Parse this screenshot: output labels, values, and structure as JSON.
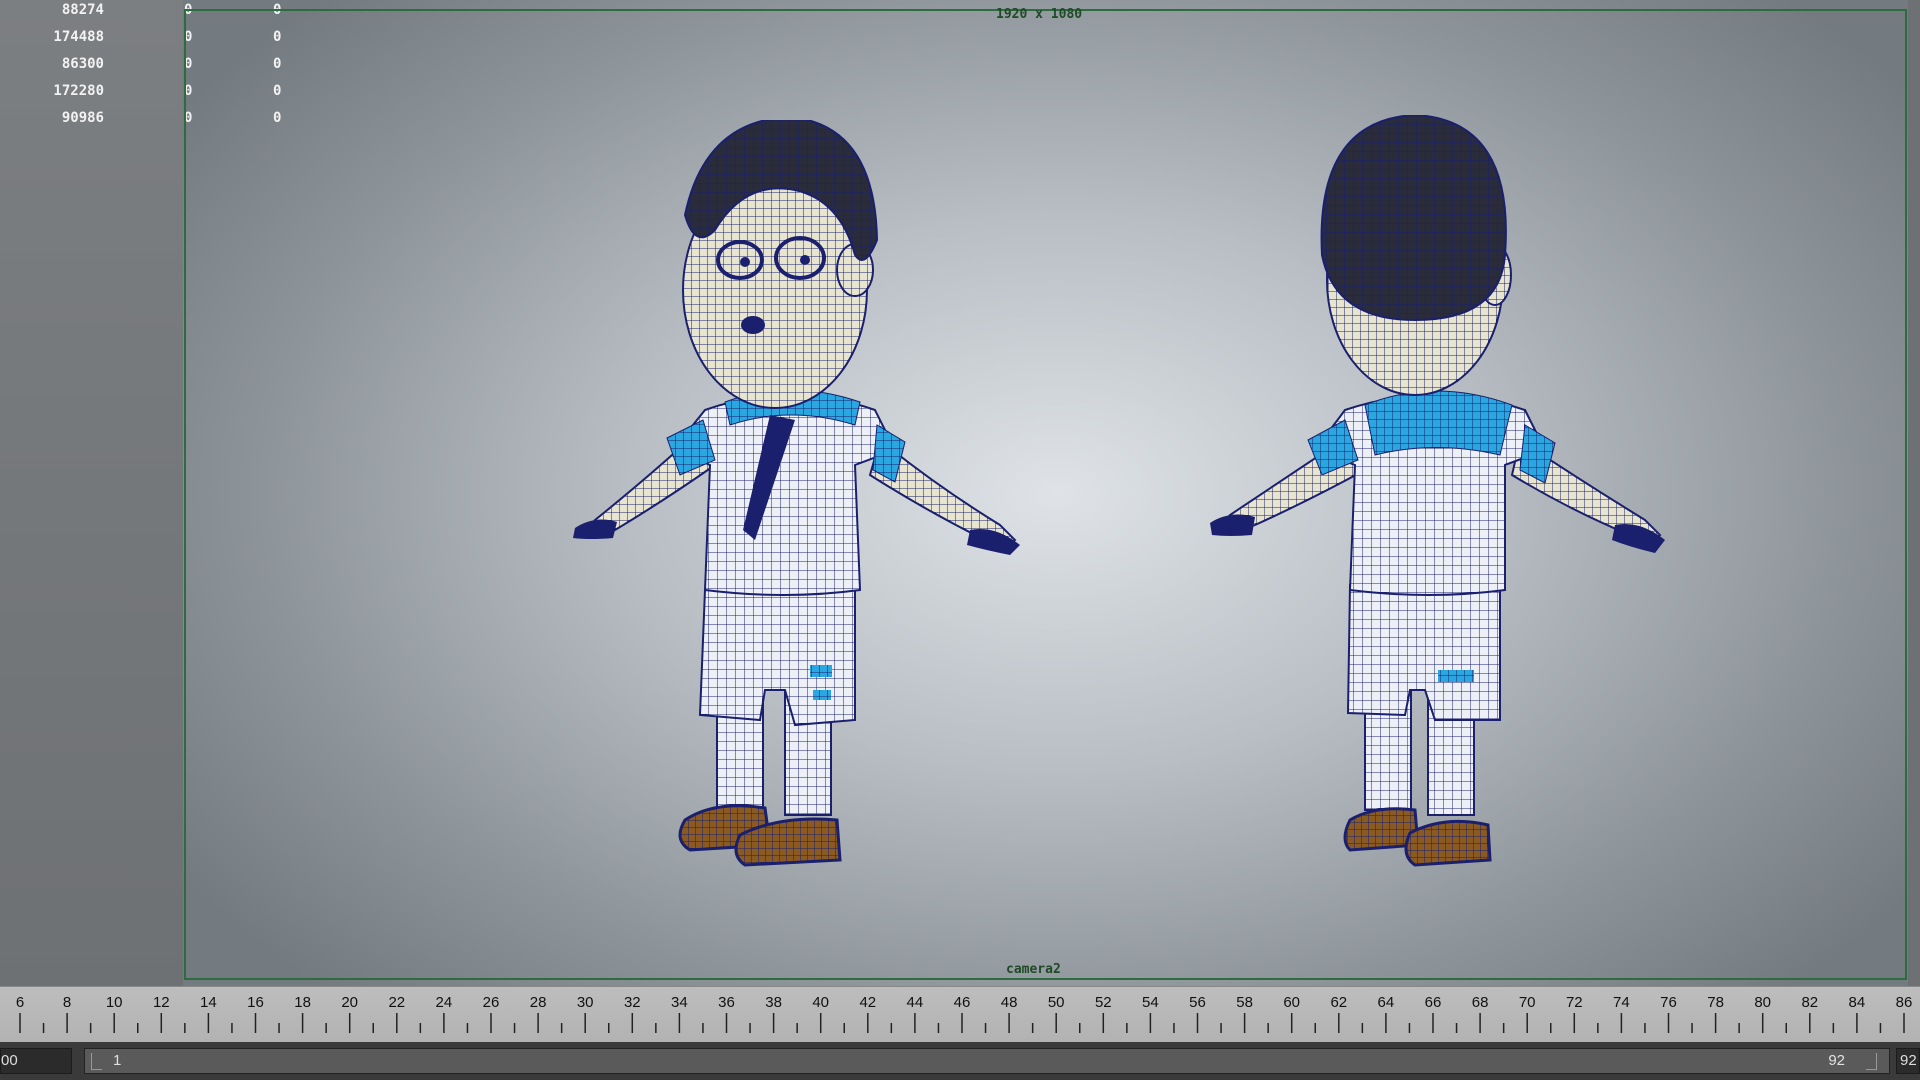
{
  "viewport": {
    "gate_resolution": "1920 x 1080",
    "camera_name": "camera2",
    "hud_rows": [
      {
        "count": "88274",
        "a": "0",
        "b": "0"
      },
      {
        "count": "174488",
        "a": "0",
        "b": "0"
      },
      {
        "count": "86300",
        "a": "0",
        "b": "0"
      },
      {
        "count": "172280",
        "a": "0",
        "b": "0"
      },
      {
        "count": "90986",
        "a": "0",
        "b": "0"
      }
    ],
    "gate_color": "#2e6b3e"
  },
  "characters": {
    "wire_color": "#1a1f6e",
    "shirt_accent_color": "#2aa6e0",
    "shoe_color": "#8a5a22"
  },
  "timeline": {
    "ticks": [
      "6",
      "8",
      "10",
      "12",
      "14",
      "16",
      "18",
      "20",
      "22",
      "24",
      "26",
      "28",
      "30",
      "32",
      "34",
      "36",
      "38",
      "40",
      "42",
      "44",
      "46",
      "48",
      "50",
      "52",
      "54",
      "56",
      "58",
      "60",
      "62",
      "64",
      "66",
      "68",
      "70",
      "72",
      "74",
      "76",
      "78",
      "80",
      "82",
      "84",
      "86"
    ]
  },
  "range": {
    "start_field": "00",
    "slider_min": "1",
    "slider_max": "92",
    "end_field": "92"
  }
}
